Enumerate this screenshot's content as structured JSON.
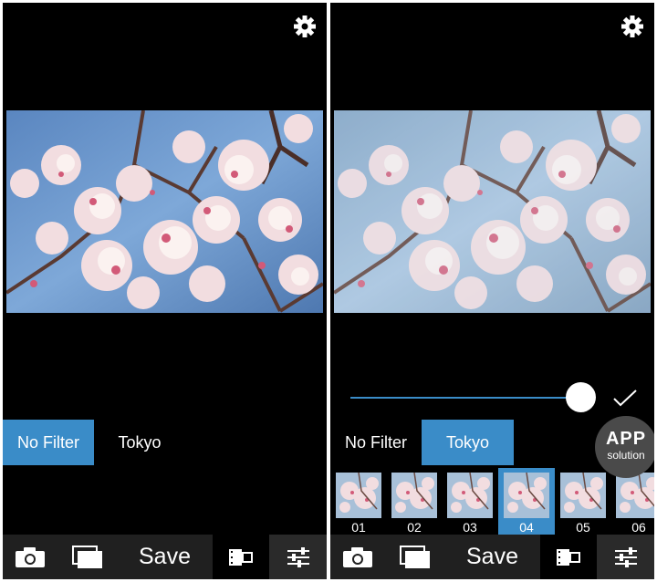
{
  "left_screen": {
    "filters": [
      "No Filter",
      "Tokyo"
    ],
    "active_filter": "No Filter",
    "toolbar": {
      "save_label": "Save"
    }
  },
  "right_screen": {
    "filters": [
      "No Filter",
      "Tokyo"
    ],
    "active_filter": "Tokyo",
    "slider_value": 0.92,
    "thumbnails": [
      "01",
      "02",
      "03",
      "04",
      "05",
      "06"
    ],
    "active_thumbnail": "04",
    "toolbar": {
      "save_label": "Save"
    },
    "watermark": {
      "line1": "APP",
      "line2": "solution"
    }
  },
  "colors": {
    "accent": "#3a8cc8",
    "background": "#000000",
    "toolbar": "#202020"
  },
  "icons": [
    "gear-icon",
    "camera-icon",
    "gallery-icon",
    "film-icon",
    "sliders-icon",
    "check-icon"
  ]
}
